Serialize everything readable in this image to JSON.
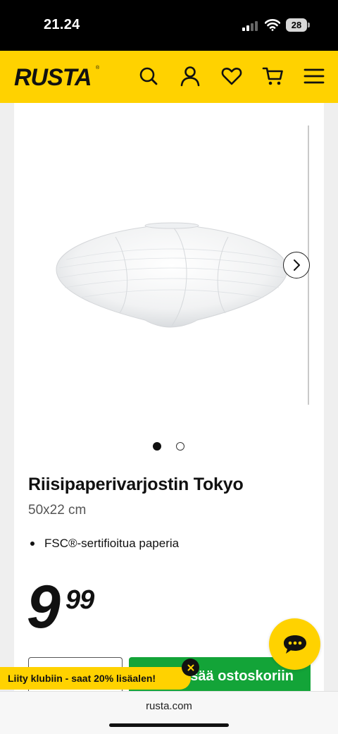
{
  "status_bar": {
    "time": "21.24",
    "battery_level": "28",
    "icons": [
      "signal-icon",
      "wifi-icon",
      "battery-icon"
    ]
  },
  "header": {
    "logo": "RUSTA",
    "logo_mark": "®",
    "background_color": "#ffd200",
    "icons": [
      "search-icon",
      "account-icon",
      "wishlist-heart-icon",
      "cart-icon",
      "menu-icon"
    ]
  },
  "gallery": {
    "image_count": 2,
    "active_image": 1,
    "next_icon": "chevron-right-icon"
  },
  "product": {
    "title": "Riisipaperivarjostin Tokyo",
    "size": "50x22 cm",
    "features": [
      "FSC®-sertifioitua paperia"
    ],
    "price_integer": "9",
    "price_decimals": "99"
  },
  "actions": {
    "add_to_cart_label": "Lisää ostoskoriin",
    "add_to_cart_color": "#13a438",
    "chat_icon": "chat-bubble-icon"
  },
  "club_banner": {
    "text": "Liity klubiin - saat 20% lisäalen!",
    "close_icon": "close-icon"
  },
  "browser": {
    "url": "rusta.com"
  }
}
